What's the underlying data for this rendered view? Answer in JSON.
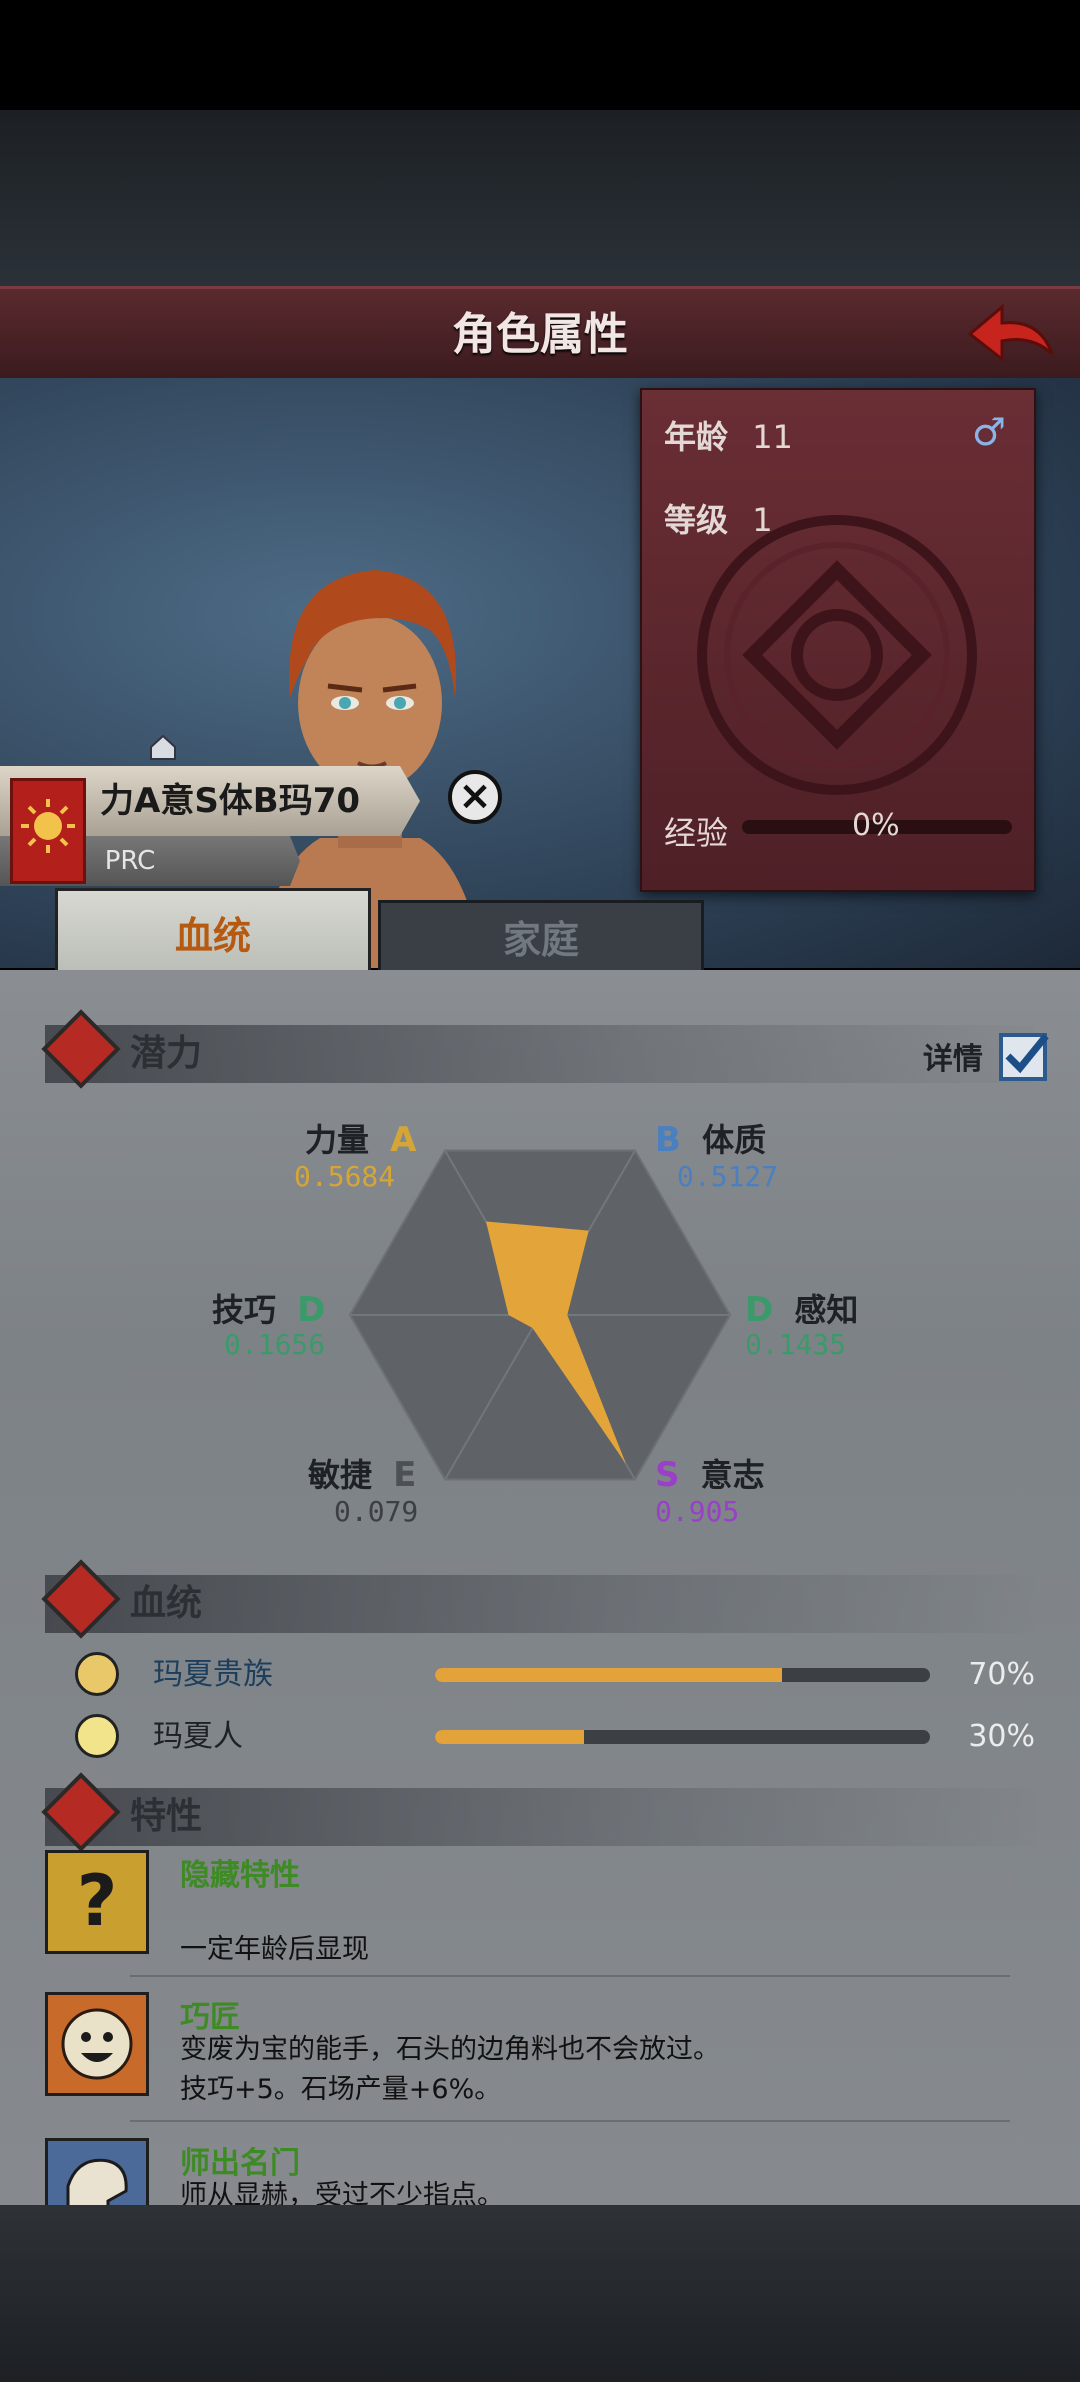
{
  "header": {
    "title": "角色属性"
  },
  "character": {
    "age_label": "年龄",
    "age": "11",
    "gender_symbol": "♂",
    "level_label": "等级",
    "level": "1",
    "exp_label": "经验",
    "exp_pct": "0%",
    "exp_fraction": 0.0
  },
  "nameplate": {
    "name": "力A意S体B玛70",
    "sub": "PRC"
  },
  "tabs": {
    "bloodline": "血统",
    "family": "家庭"
  },
  "potential": {
    "title": "潜力",
    "detail_label": "详情",
    "stats": [
      {
        "name": "力量",
        "grade": "A",
        "value": "0.5684",
        "color": "#d4a637"
      },
      {
        "name": "体质",
        "grade": "B",
        "value": "0.5127",
        "color": "#4a7fc0"
      },
      {
        "name": "感知",
        "grade": "D",
        "value": "0.1435",
        "color": "#3b9a6a"
      },
      {
        "name": "意志",
        "grade": "S",
        "value": "0.905",
        "color": "#9a3fc8"
      },
      {
        "name": "敏捷",
        "grade": "E",
        "value": "0.079",
        "color": "#6a6e72"
      },
      {
        "name": "技巧",
        "grade": "D",
        "value": "0.1656",
        "color": "#3b9a6a"
      }
    ]
  },
  "chart_data": {
    "type": "radar",
    "categories": [
      "力量",
      "体质",
      "感知",
      "意志",
      "敏捷",
      "技巧"
    ],
    "values": [
      0.5684,
      0.5127,
      0.1435,
      0.905,
      0.079,
      0.1656
    ],
    "grades": [
      "A",
      "B",
      "D",
      "S",
      "E",
      "D"
    ],
    "fill_color": "#e3a53a",
    "range": [
      0,
      1
    ]
  },
  "bloodline": {
    "title": "血统",
    "items": [
      {
        "name": "玛夏贵族",
        "pct": "70%",
        "fraction": 0.7
      },
      {
        "name": "玛夏人",
        "pct": "30%",
        "fraction": 0.3
      }
    ]
  },
  "traits": {
    "title": "特性",
    "items": [
      {
        "name": "隐藏特性",
        "desc1": "",
        "desc2": "一定年龄后显现",
        "icon": "question-icon"
      },
      {
        "name": "巧匠",
        "desc1": "变废为宝的能手，石头的边角料也不会放过。",
        "desc2": "技巧+5。石场产量+6%。",
        "icon": "smile-sun-icon"
      },
      {
        "name": "师出名门",
        "desc1": "师从显赫，受过不少指点。",
        "desc2": "",
        "icon": "mentor-icon"
      }
    ]
  }
}
